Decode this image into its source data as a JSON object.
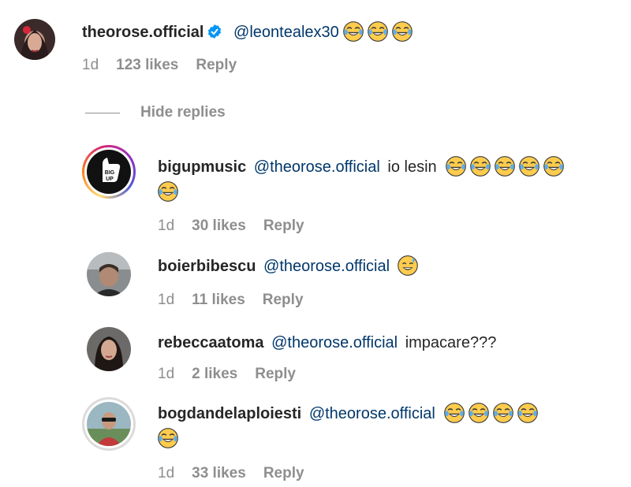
{
  "top_comment": {
    "username": "theorose.official",
    "mention": "@leontealex30",
    "emoji_count": 3,
    "time": "1d",
    "likes": "123 likes",
    "reply": "Reply"
  },
  "replies_toggle": {
    "label": "Hide replies"
  },
  "replies": [
    {
      "username": "bigupmusic",
      "mention": "@theorose.official",
      "text": "io lesin",
      "emoji_line1": 5,
      "emoji_line2": 1,
      "time": "1d",
      "likes": "30 likes",
      "reply": "Reply",
      "avatar_badge": "BIG UP"
    },
    {
      "username": "boierbibescu",
      "mention": "@theorose.official",
      "text": "",
      "emoji_line1": 1,
      "emoji_type": "sweat-smile",
      "time": "1d",
      "likes": "11 likes",
      "reply": "Reply"
    },
    {
      "username": "rebeccaatoma",
      "mention": "@theorose.official",
      "text": "impacare???",
      "time": "1d",
      "likes": "2 likes",
      "reply": "Reply"
    },
    {
      "username": "bogdandelaploiesti",
      "mention": "@theorose.official",
      "text": "",
      "emoji_line1": 4,
      "emoji_line2": 1,
      "time": "1d",
      "likes": "33 likes",
      "reply": "Reply"
    }
  ],
  "colors": {
    "username": "#262626",
    "mention": "#00376b",
    "meta": "#8e8e8e",
    "verified": "#0095f6",
    "emoji": "#ffcc4d"
  },
  "icons": [
    "verified-badge-icon",
    "joy-emoji-icon",
    "sweat-smile-emoji-icon"
  ]
}
